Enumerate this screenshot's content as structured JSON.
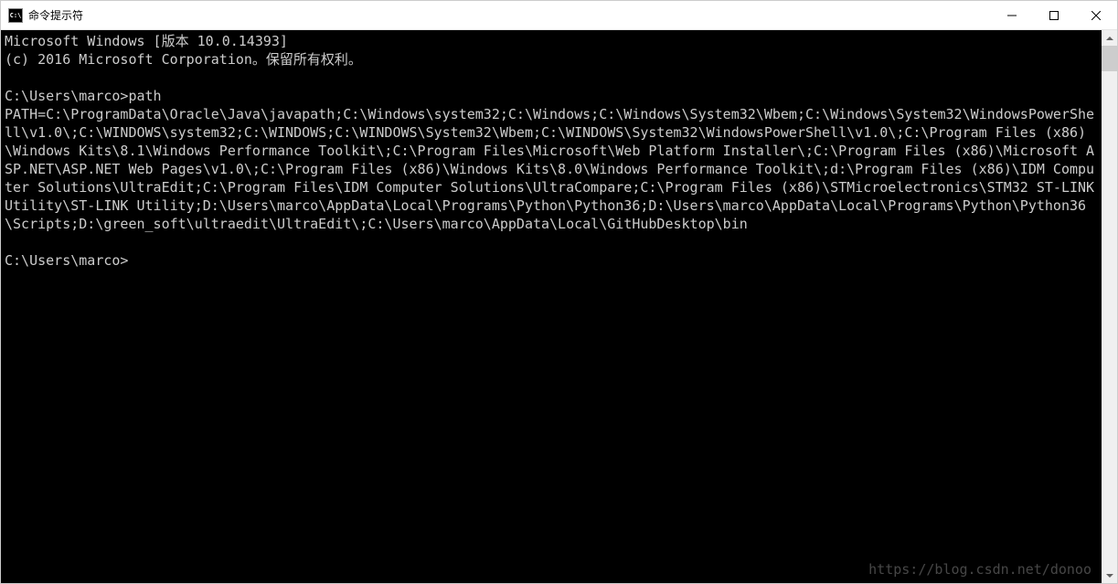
{
  "window": {
    "title": "命令提示符",
    "icon_text": "C:\\"
  },
  "terminal": {
    "header_line1": "Microsoft Windows [版本 10.0.14393]",
    "header_line2": "(c) 2016 Microsoft Corporation。保留所有权利。",
    "prompt1_prefix": "C:\\Users\\marco>",
    "prompt1_command": "path",
    "path_output": "PATH=C:\\ProgramData\\Oracle\\Java\\javapath;C:\\Windows\\system32;C:\\Windows;C:\\Windows\\System32\\Wbem;C:\\Windows\\System32\\WindowsPowerShell\\v1.0\\;C:\\WINDOWS\\system32;C:\\WINDOWS;C:\\WINDOWS\\System32\\Wbem;C:\\WINDOWS\\System32\\WindowsPowerShell\\v1.0\\;C:\\Program Files (x86)\\Windows Kits\\8.1\\Windows Performance Toolkit\\;C:\\Program Files\\Microsoft\\Web Platform Installer\\;C:\\Program Files (x86)\\Microsoft ASP.NET\\ASP.NET Web Pages\\v1.0\\;C:\\Program Files (x86)\\Windows Kits\\8.0\\Windows Performance Toolkit\\;d:\\Program Files (x86)\\IDM Computer Solutions\\UltraEdit;C:\\Program Files\\IDM Computer Solutions\\UltraCompare;C:\\Program Files (x86)\\STMicroelectronics\\STM32 ST-LINK Utility\\ST-LINK Utility;D:\\Users\\marco\\AppData\\Local\\Programs\\Python\\Python36;D:\\Users\\marco\\AppData\\Local\\Programs\\Python\\Python36\\Scripts;D:\\green_soft\\ultraedit\\UltraEdit\\;C:\\Users\\marco\\AppData\\Local\\GitHubDesktop\\bin",
    "prompt2_prefix": "C:\\Users\\marco>",
    "prompt2_command": ""
  },
  "watermark": "https://blog.csdn.net/donoo"
}
